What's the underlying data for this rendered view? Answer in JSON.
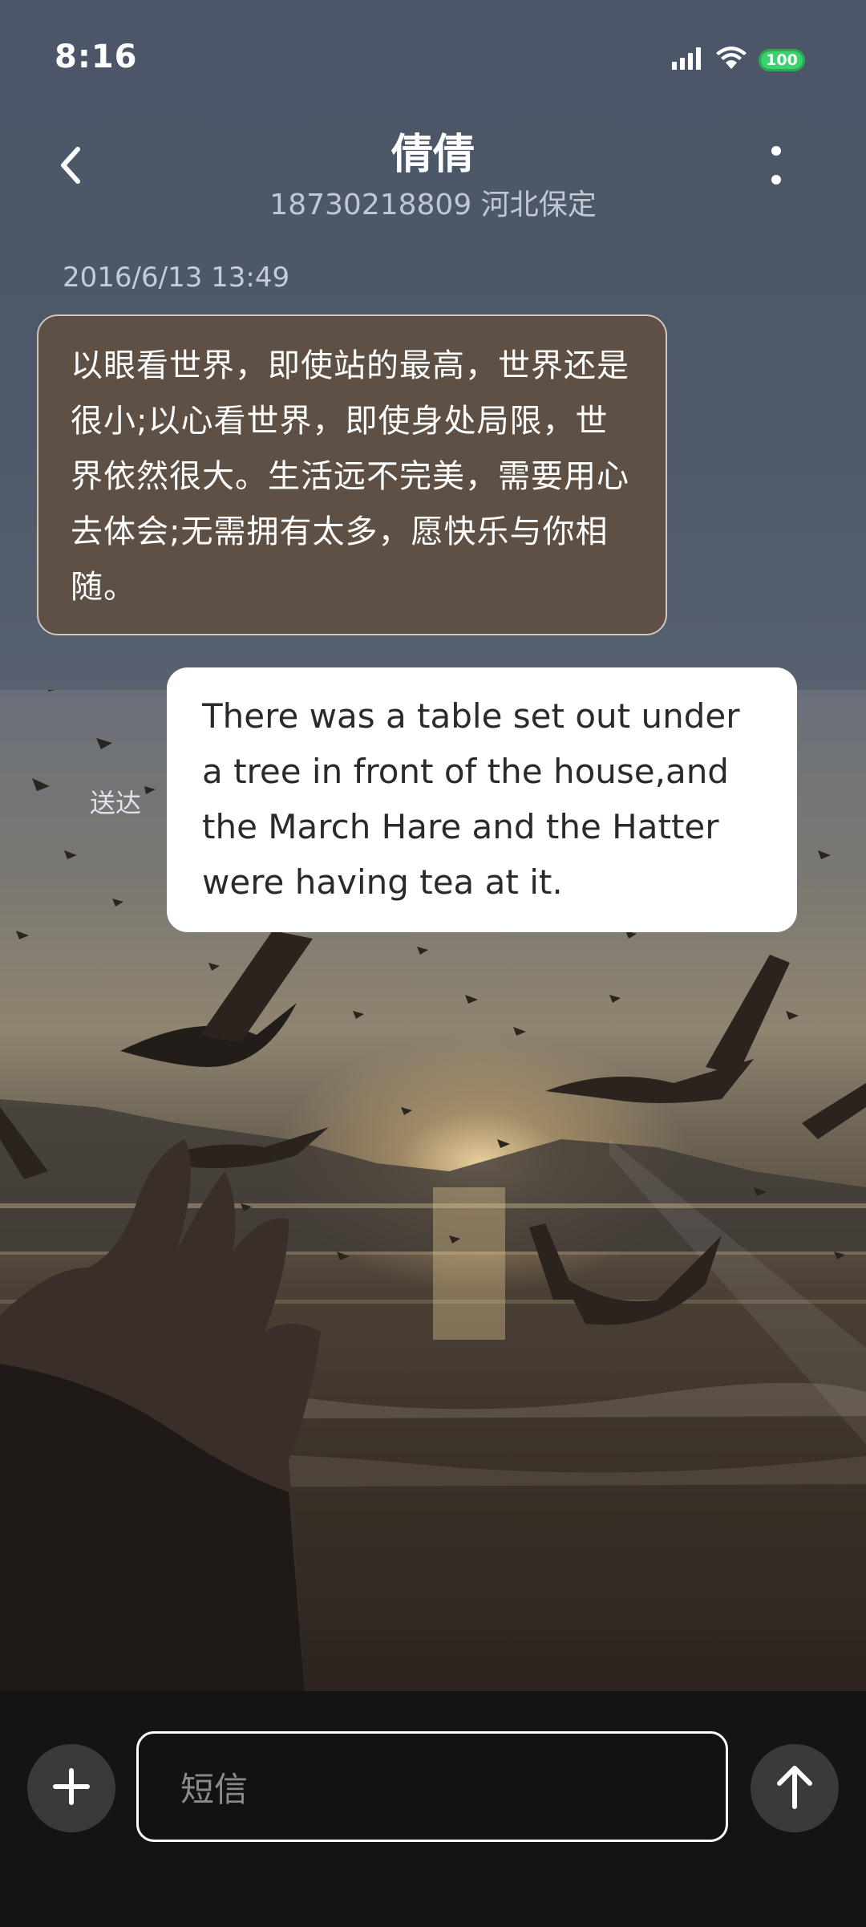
{
  "status_bar": {
    "time": "8:16",
    "battery": "100"
  },
  "header": {
    "contact_name": "倩倩",
    "contact_subtitle": "18730218809 河北保定"
  },
  "conversation": {
    "timestamp": "2016/6/13 13:49",
    "messages": [
      {
        "direction": "incoming",
        "text": "以眼看世界，即使站的最高，世界还是很小;以心看世界，即使身处局限，世界依然很大。生活远不完美，需要用心去体会;无需拥有太多，愿快乐与你相随。"
      },
      {
        "direction": "outgoing",
        "text": "There was a table set out under a tree in front of the house,and the March Hare and the Hatter were having tea at it.",
        "status": "送达"
      }
    ]
  },
  "composer": {
    "placeholder": "短信"
  },
  "icons": {
    "back": "chevron-left-icon",
    "more": "more-vertical-icon",
    "attach": "plus-icon",
    "send": "arrow-up-icon",
    "signal": "signal-icon",
    "wifi": "wifi-icon",
    "battery": "battery-icon"
  },
  "colors": {
    "incoming_bubble": "#5f5044",
    "outgoing_bubble": "#ffffff",
    "battery_fill": "#3bd16f",
    "background_top": "#4b5668",
    "bottom_bar": "#141414"
  }
}
